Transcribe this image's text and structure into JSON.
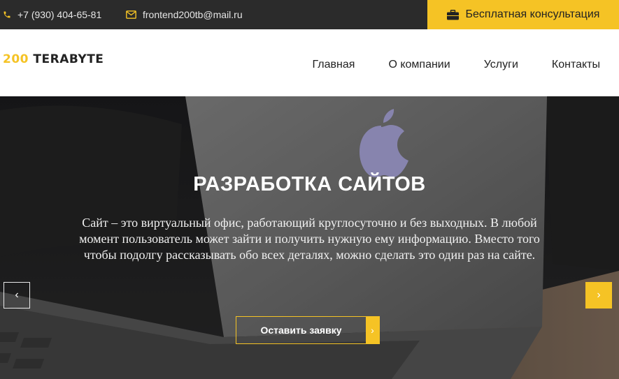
{
  "topbar": {
    "phone": "+7 (930) 404-65-81",
    "email": "frontend200tb@mail.ru",
    "cta_label": "Бесплатная консультация",
    "accent": "#f5c325"
  },
  "logo": {
    "number": "200",
    "name": " TERABYTE"
  },
  "nav": {
    "items": [
      {
        "label": "Главная"
      },
      {
        "label": "О компании"
      },
      {
        "label": "Услуги"
      },
      {
        "label": "Контакты"
      }
    ]
  },
  "hero": {
    "title": "РАЗРАБОТКА САЙТОВ",
    "text": "Сайт – это виртуальный офис, работающий круглосуточно и без выходных. В любой момент пользователь может зайти и получить нужную ему информацию. Вместо того чтобы подолгу рассказывать обо всех деталях, можно сделать это один раз на сайте.",
    "button_label": "Оставить заявку",
    "prev_glyph": "‹",
    "next_glyph": "›",
    "chevron_glyph": "›"
  },
  "icons": [
    "phone-icon",
    "mail-icon",
    "briefcase-icon",
    "apple-logo-icon"
  ]
}
